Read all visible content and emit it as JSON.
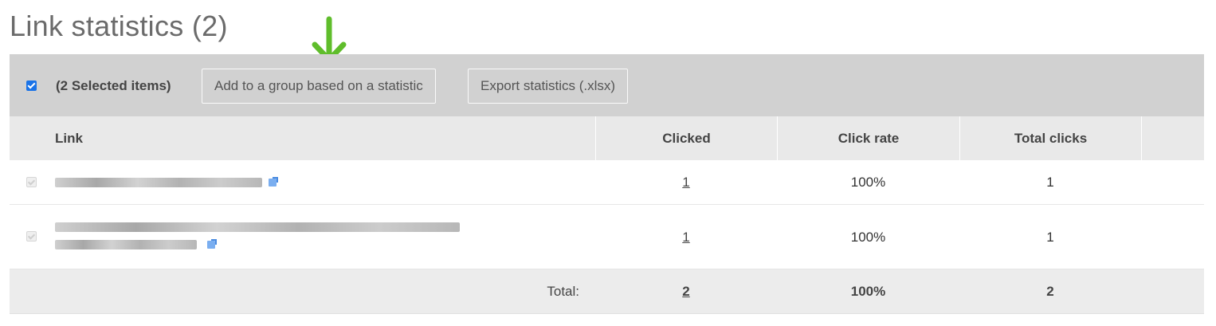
{
  "page": {
    "title": "Link statistics (2)"
  },
  "toolbar": {
    "selected_label": "(2 Selected items)",
    "add_group_label": "Add to a group based on a statistic",
    "export_label": "Export statistics (.xlsx)"
  },
  "table": {
    "headers": {
      "link": "Link",
      "clicked": "Clicked",
      "click_rate": "Click rate",
      "total_clicks": "Total clicks"
    },
    "rows": [
      {
        "clicked": "1",
        "click_rate": "100%",
        "total_clicks": "1"
      },
      {
        "clicked": "1",
        "click_rate": "100%",
        "total_clicks": "1"
      }
    ],
    "total": {
      "label": "Total:",
      "clicked": "2",
      "click_rate": "100%",
      "total_clicks": "2"
    }
  },
  "colors": {
    "accent_checkbox": "#1a73e8",
    "arrow": "#5fbd2b",
    "toolbar_bg": "#d1d1d1",
    "header_bg": "#e9e9e9"
  },
  "icons": [
    "arrow-down-icon",
    "external-link-icon"
  ]
}
